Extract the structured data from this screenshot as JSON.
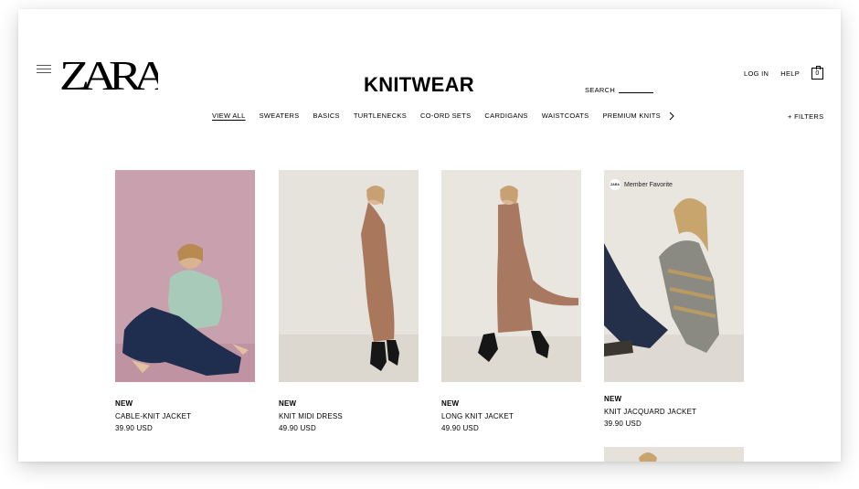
{
  "brand": {
    "logo_text": "ZARA"
  },
  "header": {
    "title": "KNITWEAR",
    "search_label": "SEARCH",
    "login_label": "LOG IN",
    "help_label": "HELP",
    "cart_count": "0"
  },
  "categories": [
    {
      "label": "VIEW ALL",
      "active": true
    },
    {
      "label": "SWEATERS"
    },
    {
      "label": "BASICS"
    },
    {
      "label": "TURTLENECKS"
    },
    {
      "label": "CO-ORD SETS"
    },
    {
      "label": "CARDIGANS"
    },
    {
      "label": "WAISTCOATS"
    },
    {
      "label": "PREMIUM KNITS"
    }
  ],
  "filters_label": "+ FILTERS",
  "products": [
    {
      "tag": "NEW",
      "name": "CABLE-KNIT JACKET",
      "price": "39.90 USD"
    },
    {
      "tag": "NEW",
      "name": "KNIT MIDI DRESS",
      "price": "49.90 USD"
    },
    {
      "tag": "NEW",
      "name": "LONG KNIT JACKET",
      "price": "49.90 USD"
    },
    {
      "tag": "NEW",
      "name": "KNIT JACQUARD JACKET",
      "price": "39.90 USD",
      "badge": "Member Favorite",
      "badge_logo": "ZARA"
    }
  ],
  "colors": {
    "accent": "#000000",
    "photo1_bg": "#c9a0ad",
    "photo_bg_neutral": "#e8e4de"
  }
}
